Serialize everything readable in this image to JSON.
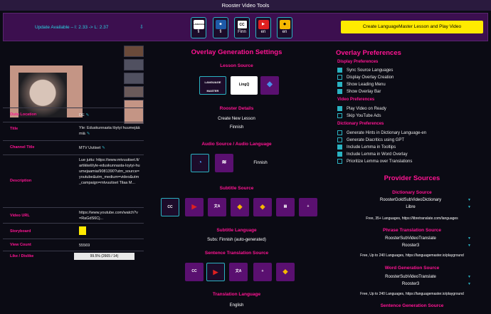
{
  "window": {
    "title": "Rooster Video Tools"
  },
  "update": {
    "text": "Update Available – I: 2.33 -> L: 2.37",
    "icon": "download-icon"
  },
  "toolbar": {
    "buttons": [
      {
        "name": "languagemaster",
        "label": "fi",
        "icon": "LANGUAGE MASTER"
      },
      {
        "name": "yellow-fi",
        "label": "fi",
        "icon": "face"
      },
      {
        "name": "cc",
        "label": "Finn",
        "icon": "CC"
      },
      {
        "name": "youtube",
        "label": "en",
        "icon": "▶"
      },
      {
        "name": "lingq",
        "label": "en",
        "icon": "Q"
      }
    ],
    "cta": "Create LanguageMaster Lesson and Play Video"
  },
  "meta": [
    {
      "k": "Outu Location",
      "v": "DE"
    },
    {
      "k": "Title",
      "v": "Yle: Eduskunnasta löytyi huumejäämiä"
    },
    {
      "k": "Channel Title",
      "v": "MTV Uutiset"
    },
    {
      "k": "Description",
      "v": "Lue juttu: https://www.mtvuutiset.fi/artikkeli/yle-eduskunnasta-loytyi-huumejaamia/9081390?utm_source=youtube&utm_medium=video&utm_campaign=mtvuutiset Tilaa M..."
    },
    {
      "k": "Video URL",
      "v": "https://www.youtube.com/watch?v=RaGdS6Cj..."
    },
    {
      "k": "Storyboard",
      "v": ""
    },
    {
      "k": "View Count",
      "v": "55569"
    },
    {
      "k": "Like / Dislike",
      "v": "99.5% (2665 / 14)"
    }
  ],
  "overlay": {
    "title": "Overlay Generation Settings",
    "lesson_source": "Lesson Source",
    "rooster_details": "Rooster Details",
    "create_new_lesson": "Create New Lesson",
    "lang": "Finnish",
    "audio_title": "Audio Source / Audio Language",
    "audio_lang": "Finnish",
    "subtitle_source": "Subtitle Source",
    "subtitle_language": "Subtitle Language",
    "subs_value": "Subs: Finnish (auto-generated)",
    "sentence_translation": "Sentence Translation Source",
    "translation_language": "Translation Language",
    "translation_value": "English"
  },
  "prefs": {
    "title": "Overlay Preferences",
    "display_h": "Display Preferences",
    "display": [
      {
        "label": "Sync Source Languages",
        "on": true
      },
      {
        "label": "Display Overlay Creation",
        "on": false
      },
      {
        "label": "Show Leading Menu",
        "on": true
      },
      {
        "label": "Show Overlay Bar",
        "on": true
      }
    ],
    "video_h": "Video Preferences",
    "video": [
      {
        "label": "Play Video on Ready",
        "on": true
      },
      {
        "label": "Skip YouTube Ads",
        "on": false
      }
    ],
    "dict_h": "Dictionary Preferences",
    "dict": [
      {
        "label": "Generate Hints in Dictionary Language-en",
        "on": false
      },
      {
        "label": "Generate Diacritics using GPT",
        "on": false
      },
      {
        "label": "Include Lemma in Tooltips",
        "on": true
      },
      {
        "label": "Include Lemma in Word Overlay",
        "on": true
      },
      {
        "label": "Prioritize Lemma over Translations",
        "on": false
      }
    ]
  },
  "providers": {
    "title": "Provider Sources",
    "dict_src": "Dictionary Source",
    "dict_val": "RoosterGoldSubVideoDictionary",
    "dict_sub": "Libre",
    "dict_note": "Free, 35+ Languages, https://libretranslate.com/languages",
    "phrase_src": "Phrase Translation Source",
    "phrase_val": "RoosterSubVideoTranslate",
    "phrase_sub": "Rooster3",
    "phrase_note": "Free, Up to 240 Languages, https://languagemaster.io/playground",
    "word_src": "Word Generation Source",
    "word_val": "RoosterSubVideoTranslate",
    "word_sub": "Rooster3",
    "word_note": "Free, Up to 240 Languages, https://languagemaster.io/playground",
    "sent_src": "Sentence Generation Source"
  }
}
